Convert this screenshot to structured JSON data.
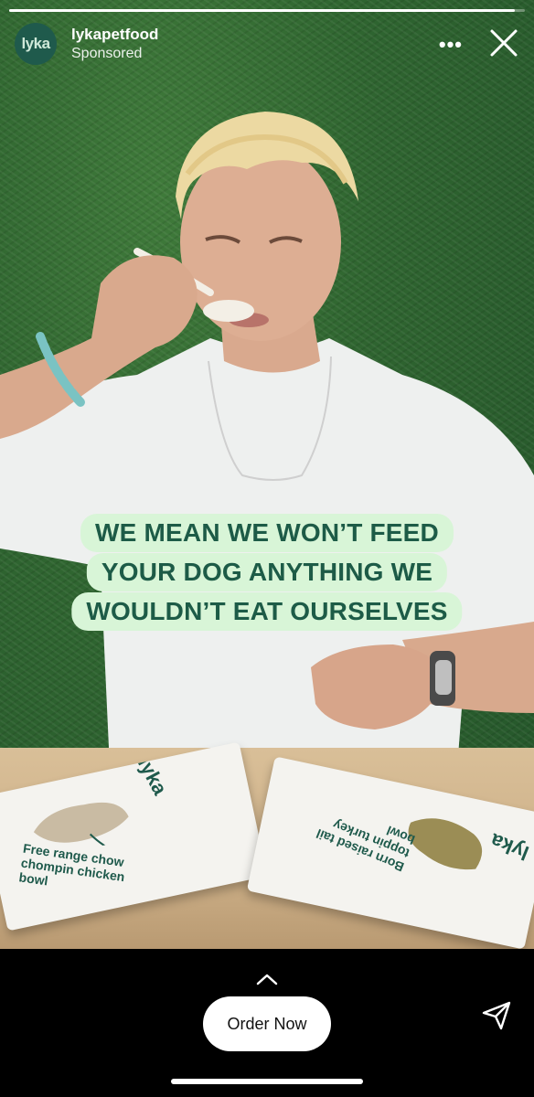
{
  "story": {
    "progress": 0.98,
    "account_name": "lykapetfood",
    "sponsored_label": "Sponsored",
    "avatar_text": "lyka",
    "more_icon": "more-horizontal-icon",
    "close_icon": "close-icon"
  },
  "caption": {
    "lines": [
      "WE MEAN WE WON’T FEED",
      "YOUR DOG ANYTHING WE",
      "WOULDN’T EAT OURSELVES"
    ]
  },
  "packages": {
    "left": {
      "brand": "lyka",
      "text": "Free range chow chompin chicken bowl"
    },
    "right": {
      "brand": "lyka",
      "text": "Born raised tail toppin turkey bowl"
    }
  },
  "cta": {
    "chevron_icon": "chevron-up-icon",
    "order_label": "Order Now",
    "send_icon": "send-icon"
  },
  "colors": {
    "caption_bg": "#d8f5d7",
    "caption_text": "#1d5b47",
    "brand": "#1f5a4c"
  }
}
